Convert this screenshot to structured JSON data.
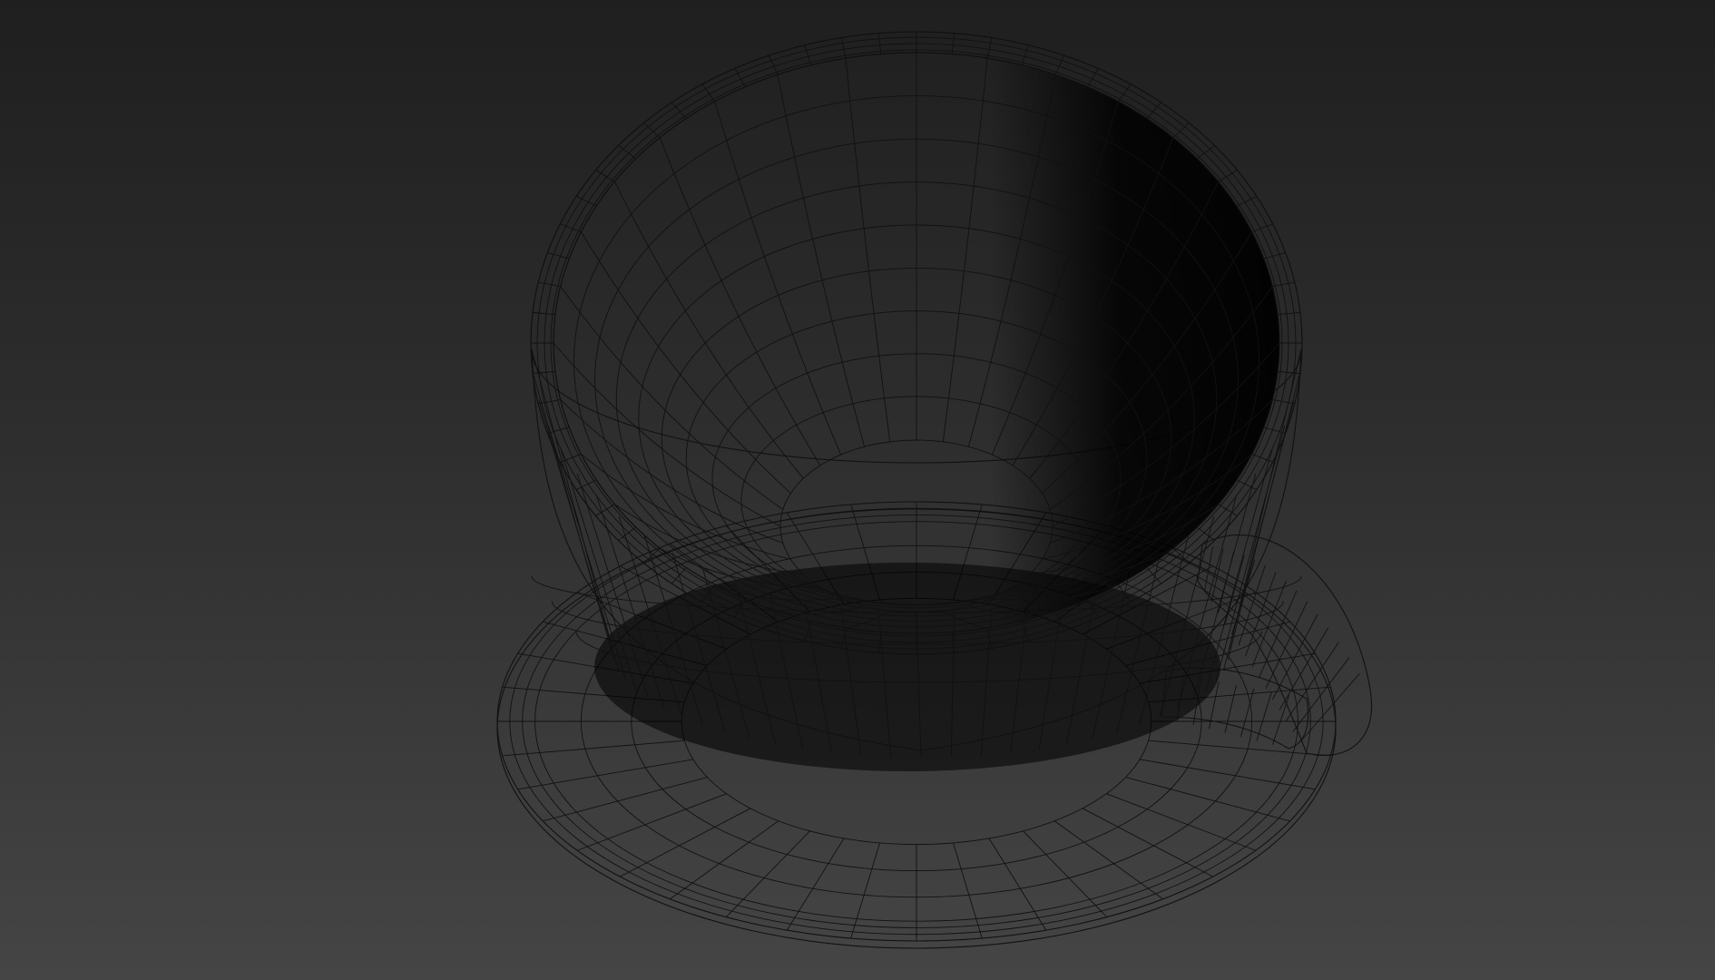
{
  "viewport": {
    "background_top": "#1f1f1f",
    "background_bottom": "#454545",
    "shading_mode": "edged-faces",
    "wire_color": "#111111",
    "surface_color": "#c8c8c8"
  },
  "scene": {
    "objects": [
      {
        "name": "teacup",
        "segments": 32
      },
      {
        "name": "saucer",
        "segments": 40
      },
      {
        "name": "handle",
        "segments": 16
      }
    ]
  }
}
